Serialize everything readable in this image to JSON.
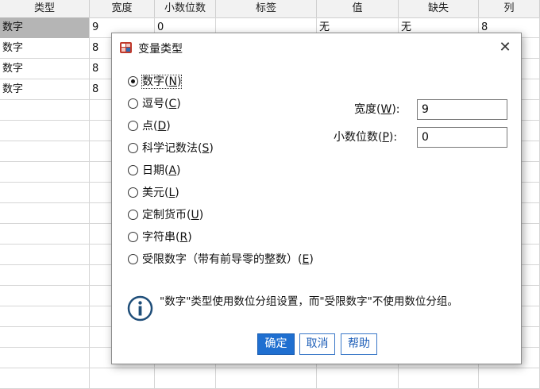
{
  "sheet": {
    "headers": [
      "类型",
      "宽度",
      "小数位数",
      "标签",
      "值",
      "缺失",
      "列"
    ],
    "rows": [
      [
        "数字",
        "9",
        "0",
        "",
        "无",
        "无",
        "8"
      ],
      [
        "数字",
        "8",
        "",
        "",
        "",
        "",
        ""
      ],
      [
        "数字",
        "8",
        "",
        "",
        "",
        "",
        ""
      ],
      [
        "数字",
        "8",
        "",
        "",
        "",
        "",
        ""
      ]
    ]
  },
  "dialog": {
    "title": "变量类型",
    "options": [
      {
        "text": "数字",
        "key": "N",
        "checked": true
      },
      {
        "text": "逗号",
        "key": "C",
        "checked": false
      },
      {
        "text": "点",
        "key": "D",
        "checked": false
      },
      {
        "text": "科学记数法",
        "key": "S",
        "checked": false
      },
      {
        "text": "日期",
        "key": "A",
        "checked": false
      },
      {
        "text": "美元",
        "key": "L",
        "checked": false
      },
      {
        "text": "定制货币",
        "key": "U",
        "checked": false
      },
      {
        "text": "字符串",
        "key": "R",
        "checked": false
      },
      {
        "text": "受限数字（带有前导零的整数）",
        "key": "E",
        "checked": false
      }
    ],
    "width_label": "宽度",
    "width_key": "W",
    "width_value": "9",
    "decimals_label": "小数位数",
    "decimals_key": "P",
    "decimals_value": "0",
    "info": "\"数字\"类型使用数位分组设置，而\"受限数字\"不使用数位分组。",
    "ok": "确定",
    "cancel": "取消",
    "help": "帮助"
  }
}
